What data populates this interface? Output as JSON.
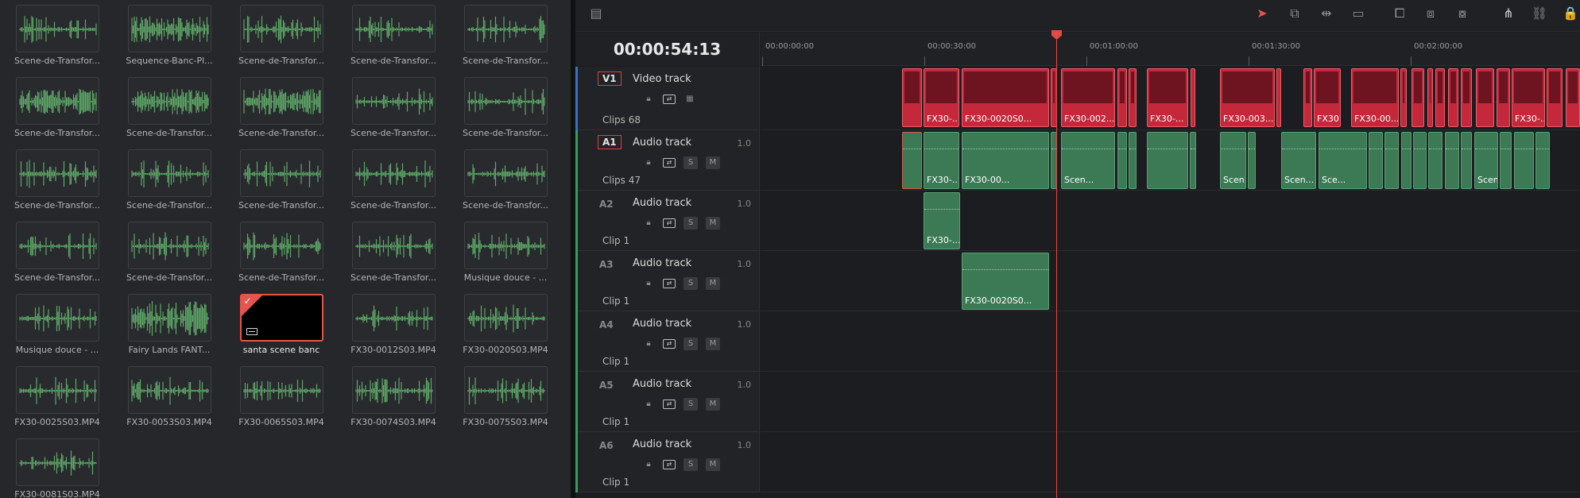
{
  "media_pool": {
    "clips": [
      {
        "name": "Scene-de-Transfor..."
      },
      {
        "name": "Sequence-Banc-Pl..."
      },
      {
        "name": "Scene-de-Transfor..."
      },
      {
        "name": "Scene-de-Transfor..."
      },
      {
        "name": "Scene-de-Transfor..."
      },
      {
        "name": "Scene-de-Transfor..."
      },
      {
        "name": "Scene-de-Transfor..."
      },
      {
        "name": "Scene-de-Transfor..."
      },
      {
        "name": "Scene-de-Transfor..."
      },
      {
        "name": "Scene-de-Transfor..."
      },
      {
        "name": "Scene-de-Transfor..."
      },
      {
        "name": "Scene-de-Transfor..."
      },
      {
        "name": "Scene-de-Transfor..."
      },
      {
        "name": "Scene-de-Transfor..."
      },
      {
        "name": "Scene-de-Transfor..."
      },
      {
        "name": "Scene-de-Transfor..."
      },
      {
        "name": "Scene-de-Transfor..."
      },
      {
        "name": "Scene-de-Transfor..."
      },
      {
        "name": "Scene-de-Transfor..."
      },
      {
        "name": "Musique douce - ..."
      },
      {
        "name": "Musique douce - ..."
      },
      {
        "name": "Fairy Lands  FANT..."
      },
      {
        "name": "santa scene banc",
        "selected": true
      },
      {
        "name": "FX30-0012S03.MP4"
      },
      {
        "name": "FX30-0020S03.MP4"
      },
      {
        "name": "FX30-0025S03.MP4"
      },
      {
        "name": "FX30-0053S03.MP4"
      },
      {
        "name": "FX30-0065S03.MP4"
      },
      {
        "name": "FX30-0074S03.MP4"
      },
      {
        "name": "FX30-0075S03.MP4"
      },
      {
        "name": "FX30-0081S03.MP4"
      }
    ]
  },
  "timeline": {
    "timecode": "00:00:54:13",
    "ruler": [
      "00:00:00:00",
      "00:00:30:00",
      "00:01:00:00",
      "00:01:30:00",
      "00:02:00:00"
    ],
    "toolbar": {
      "icons": [
        "select-arrow-icon",
        "trim-icon",
        "dynamic-trim-icon",
        "blade-icon",
        "insert-icon",
        "overwrite-icon",
        "replace-icon",
        "snap-icon",
        "link-icon",
        "lock-icon"
      ],
      "view_icon": "timeline-view-icon"
    },
    "tracks": [
      {
        "id": "V1",
        "name": "Video track",
        "count": "Clips 68"
      },
      {
        "id": "A1",
        "name": "Audio track",
        "vol": "1.0",
        "count": "Clips 47"
      },
      {
        "id": "A2",
        "name": "Audio track",
        "vol": "1.0",
        "count": "Clip 1"
      },
      {
        "id": "A3",
        "name": "Audio track",
        "vol": "1.0",
        "count": "Clip 1"
      },
      {
        "id": "A4",
        "name": "Audio track",
        "vol": "1.0",
        "count": "Clip 1"
      },
      {
        "id": "A5",
        "name": "Audio track",
        "vol": "1.0",
        "count": "Clip 1"
      },
      {
        "id": "A6",
        "name": "Audio track",
        "vol": "1.0",
        "count": "Clip 1"
      }
    ],
    "solo_label": "S",
    "mute_label": "M",
    "video_clips": [
      {
        "label": ""
      },
      {
        "label": "FX30-..."
      },
      {
        "label": "FX30-0020S0..."
      },
      {
        "label": "FX30-002..."
      },
      {
        "label": "FX30-..."
      },
      {
        "label": "FX30-003..."
      },
      {
        "label": "FX30..."
      },
      {
        "label": "FX30-00..."
      },
      {
        "label": "FX30-..."
      }
    ],
    "a1_clips": [
      {
        "label": ""
      },
      {
        "label": "FX30-..."
      },
      {
        "label": "FX30-00..."
      },
      {
        "label": "Scen..."
      },
      {
        "label": "Scen..."
      },
      {
        "label": "Scen..."
      },
      {
        "label": "Sce..."
      },
      {
        "label": "Scen..."
      }
    ],
    "a2_clip": {
      "label": "FX30-..."
    },
    "a3_clip": {
      "label": "FX30-0020S0..."
    }
  }
}
